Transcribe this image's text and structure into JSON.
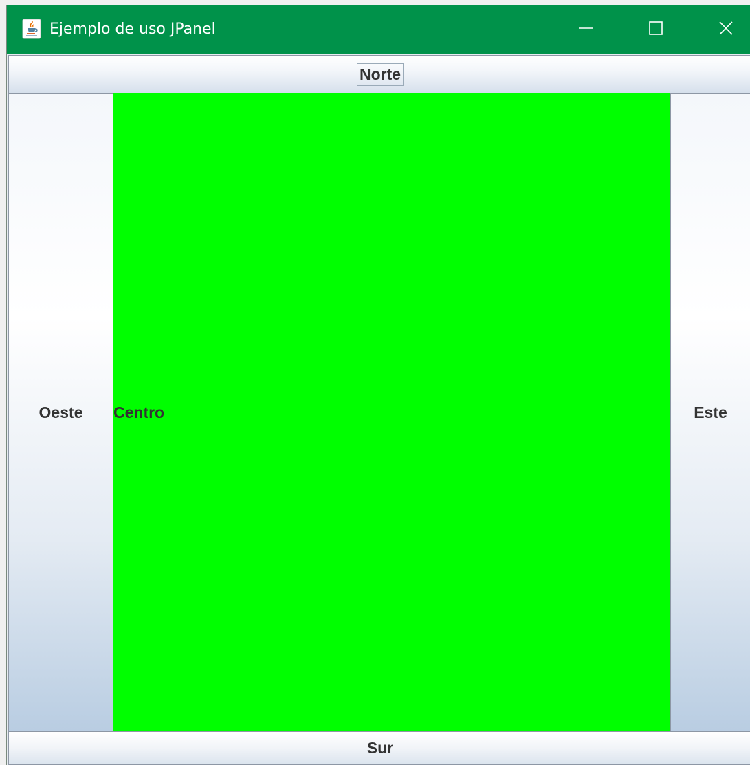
{
  "window": {
    "title": "Ejemplo de uso JPanel",
    "icon": "java-coffee-icon",
    "titlebar_color": "#00924a",
    "controls": {
      "minimize": "minimize-icon",
      "maximize": "maximize-icon",
      "close": "close-icon"
    }
  },
  "layout": {
    "north_label": "Norte",
    "west_label": "Oeste",
    "center_label": "Centro",
    "east_label": "Este",
    "south_label": "Sur",
    "center_color": "#00ff00"
  }
}
